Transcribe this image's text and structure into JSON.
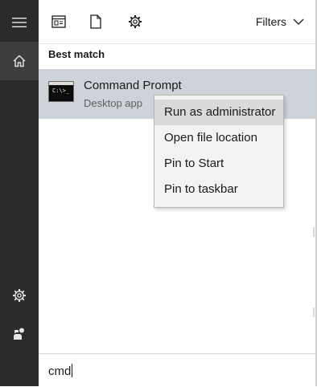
{
  "rail": {
    "items": [
      {
        "name": "menu",
        "icon": "hamburger-menu-icon"
      },
      {
        "name": "home",
        "icon": "home-icon"
      },
      {
        "name": "settings",
        "icon": "gear-icon"
      },
      {
        "name": "feedback",
        "icon": "feedback-icon"
      }
    ]
  },
  "toolbar": {
    "icons": [
      "apps-icon",
      "documents-icon",
      "settings-icon"
    ],
    "filters_label": "Filters"
  },
  "results": {
    "section_label": "Best match",
    "best_match": {
      "title": "Command Prompt",
      "subtitle": "Desktop app",
      "icon": "command-prompt-icon"
    }
  },
  "context_menu": {
    "items": [
      {
        "label": "Run as administrator",
        "hovered": true
      },
      {
        "label": "Open file location",
        "hovered": false
      },
      {
        "label": "Pin to Start",
        "hovered": false
      },
      {
        "label": "Pin to taskbar",
        "hovered": false
      }
    ]
  },
  "search": {
    "value": "cmd"
  },
  "colors": {
    "rail_bg": "#2b2b2b",
    "result_highlight": "#cdd3d9",
    "menu_bg": "#f2f2f2",
    "menu_hover": "#dadada"
  }
}
